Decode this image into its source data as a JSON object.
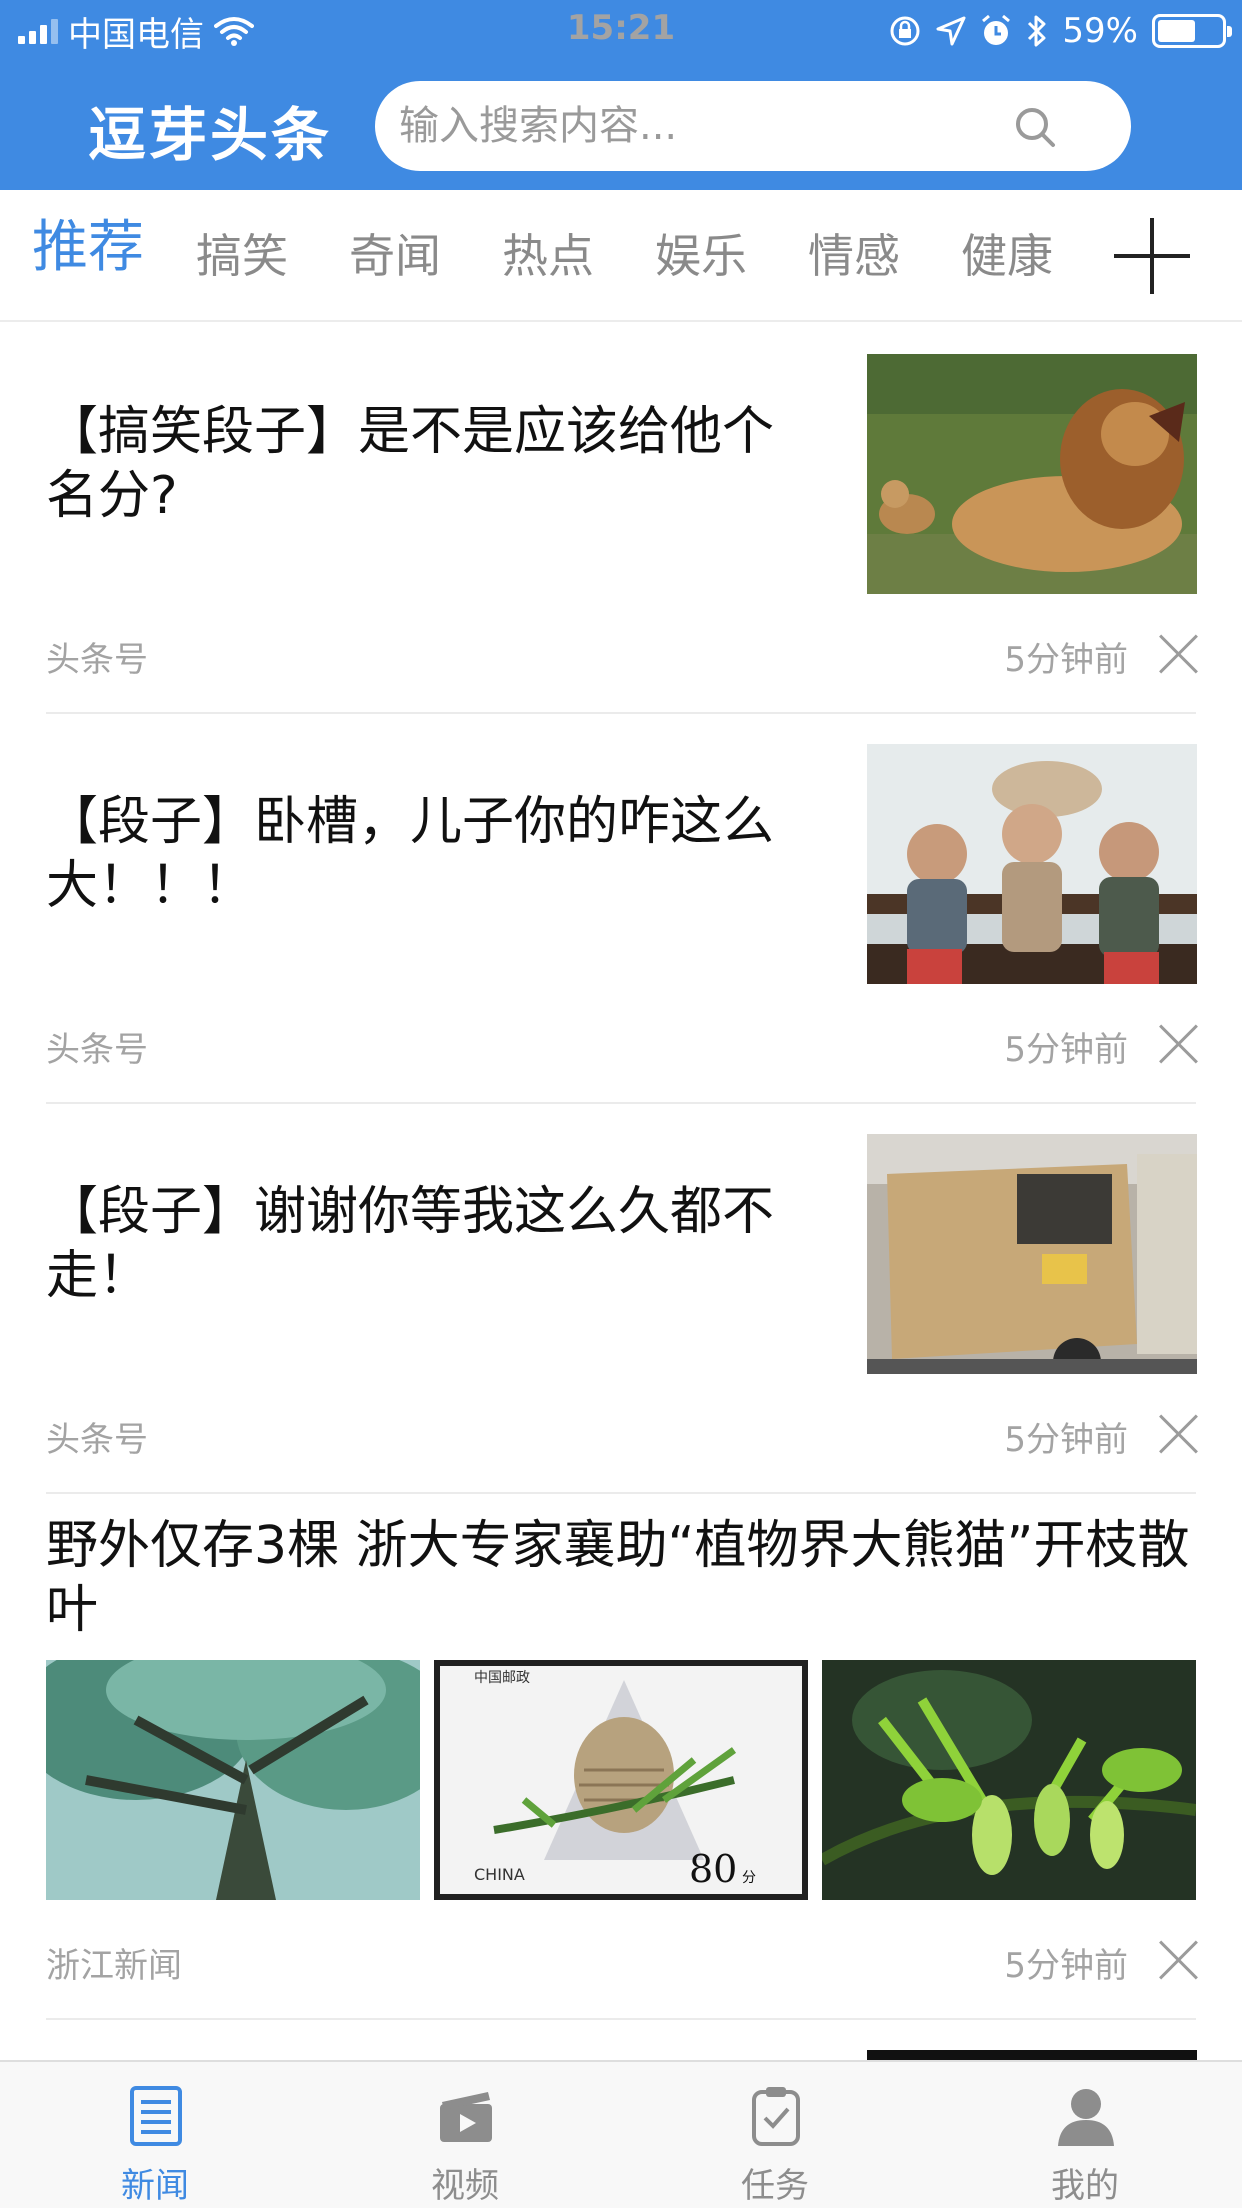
{
  "status_bar": {
    "carrier": "中国电信",
    "time": "15:21",
    "battery": "59%",
    "battery_level": 0.59,
    "icons": [
      "signal-icon",
      "wifi-icon",
      "rotation-lock-icon",
      "location-icon",
      "alarm-icon",
      "bluetooth-icon",
      "battery-icon"
    ]
  },
  "header": {
    "app_name": "逗芽头条",
    "search_placeholder": "输入搜索内容...",
    "search_icon": "search-icon",
    "background_color": "#3f8ae2"
  },
  "categories": {
    "tabs": [
      {
        "label": "推荐",
        "active": true
      },
      {
        "label": "搞笑",
        "active": false
      },
      {
        "label": "奇闻",
        "active": false
      },
      {
        "label": "热点",
        "active": false
      },
      {
        "label": "娱乐",
        "active": false
      },
      {
        "label": "情感",
        "active": false
      },
      {
        "label": "健康",
        "active": false
      }
    ],
    "add_icon": "plus-icon",
    "active_color": "#3f8ae2"
  },
  "feed": {
    "articles": [
      {
        "title": "【搞笑段子】是不是应该给他个名分?",
        "source": "头条号",
        "time": "5分钟前",
        "image": "lion-photo"
      },
      {
        "title": "【段子】卧槽，儿子你的咋这么大！！！",
        "source": "头条号",
        "time": "5分钟前",
        "image": "kids-at-zoo-photo"
      },
      {
        "title": "【段子】谢谢你等我这么久都不走！",
        "source": "头条号",
        "time": "5分钟前",
        "image": "cardboard-truck-photo"
      },
      {
        "title": "野外仅存3棵 浙大专家襄助“植物界大熊猫”开枝散叶",
        "source": "浙江新闻",
        "time": "5分钟前",
        "images": [
          "tree-photo",
          "stamp-photo",
          "pine-cone-photo"
        ]
      }
    ],
    "stamp": {
      "country": "中国邮政",
      "latin": "CHINA",
      "value": "80",
      "unit": "分"
    }
  },
  "tab_bar": {
    "items": [
      {
        "label": "新闻",
        "icon": "news-icon",
        "active": true
      },
      {
        "label": "视频",
        "icon": "video-icon",
        "active": false
      },
      {
        "label": "任务",
        "icon": "task-icon",
        "active": false
      },
      {
        "label": "我的",
        "icon": "profile-icon",
        "active": false
      }
    ]
  }
}
